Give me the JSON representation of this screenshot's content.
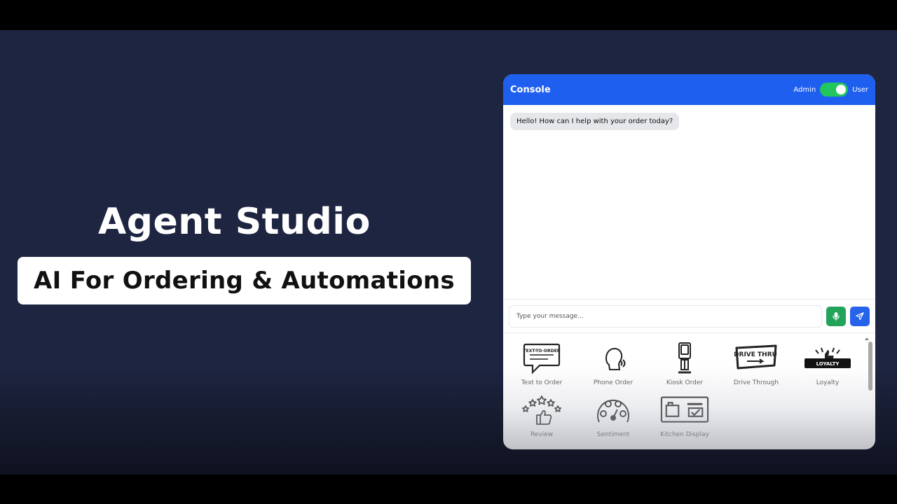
{
  "hero": {
    "title": "Agent Studio",
    "tagline": "AI For Ordering & Automations"
  },
  "console": {
    "title": "Console",
    "role_left": "Admin",
    "role_right": "User",
    "toggle_on": true,
    "greeting": "Hello! How can I help with your order today?",
    "input_placeholder": "Type your message...",
    "input_value": ""
  },
  "apps": [
    {
      "label": "Text to Order",
      "icon": "text-to-order-icon",
      "icon_text": "TEXT-TO-ORDER"
    },
    {
      "label": "Phone Order",
      "icon": "phone-order-icon"
    },
    {
      "label": "Kiosk Order",
      "icon": "kiosk-icon"
    },
    {
      "label": "Drive Through",
      "icon": "drive-thru-icon",
      "icon_text": "DRIVE THRU"
    },
    {
      "label": "Loyalty",
      "icon": "loyalty-icon",
      "icon_text": "LOYALTY"
    },
    {
      "label": "Review",
      "icon": "review-stars-icon"
    },
    {
      "label": "Sentiment",
      "icon": "sentiment-gauge-icon"
    },
    {
      "label": "Kitchen Display",
      "icon": "kitchen-display-icon"
    }
  ],
  "colors": {
    "background": "#1e2541",
    "header": "#1f5ff0",
    "toggle": "#22c55e",
    "mic": "#22a35a",
    "send": "#2563eb"
  }
}
